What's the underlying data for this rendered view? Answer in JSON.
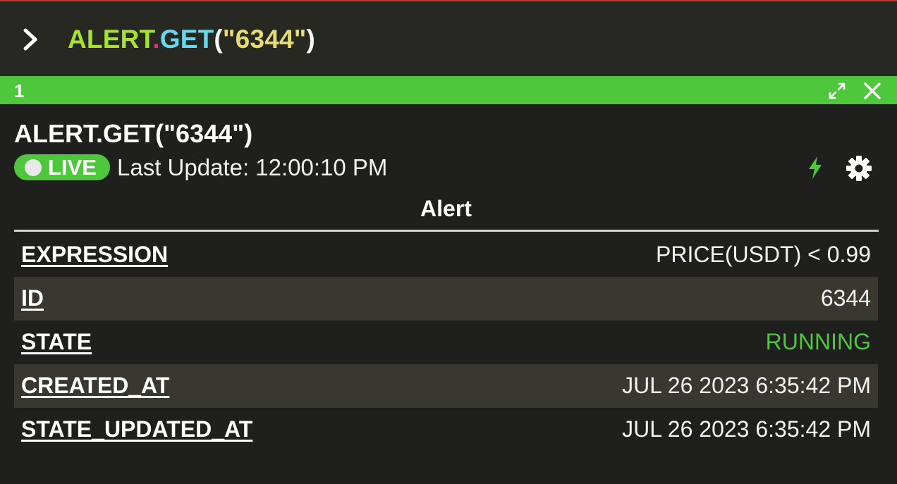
{
  "command": {
    "fn_namespace": "ALERT",
    "dot": ".",
    "fn_name": "GET",
    "open_paren": "(",
    "arg": "\"6344\"",
    "close_paren": ")"
  },
  "panel": {
    "number": "1",
    "title": "ALERT.GET(\"6344\")",
    "live_label": "LIVE",
    "last_update": "Last Update: 12:00:10 PM",
    "section_title": "Alert",
    "header_color": "#4ec73d"
  },
  "icons": {
    "prompt": "chevron-right-icon",
    "expand": "expand-icon",
    "close": "close-icon",
    "bolt": "bolt-icon",
    "gear": "gear-icon"
  },
  "rows": [
    {
      "key": "EXPRESSION",
      "value": "PRICE(USDT) < 0.99"
    },
    {
      "key": "ID",
      "value": "6344"
    },
    {
      "key": "STATE",
      "value": "RUNNING",
      "value_color": "#4ec73d"
    },
    {
      "key": "CREATED_AT",
      "value": "JUL 26 2023 6:35:42 PM"
    },
    {
      "key": "STATE_UPDATED_AT",
      "value": "JUL 26 2023 6:35:42 PM"
    }
  ]
}
